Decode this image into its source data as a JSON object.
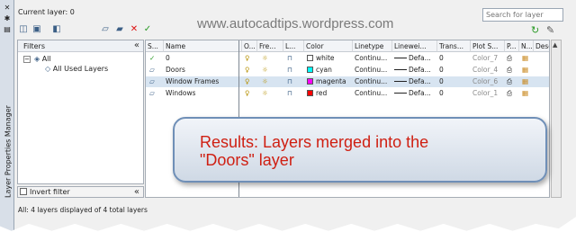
{
  "watermark": "www.autocadtips.wordpress.com",
  "header": {
    "current_layer": "Current layer: 0",
    "search_placeholder": "Search for layer"
  },
  "palette": {
    "title": "Layer Properties Manager",
    "icons": [
      "pin-icon",
      "close-icon",
      "properties-icon"
    ]
  },
  "toolbar": {
    "icons": [
      "new-property-filter-icon",
      "new-group-filter-icon",
      "layer-states-manager-icon",
      "new-layer-icon",
      "new-layer-vp-frozen-icon",
      "delete-layer-icon",
      "set-current-icon"
    ],
    "right_icons": [
      "refresh-icon",
      "settings-icon"
    ]
  },
  "filters": {
    "header": "Filters",
    "collapse": "«",
    "tree": [
      {
        "label": "All",
        "expander": "−"
      },
      {
        "label": "All Used Layers"
      }
    ],
    "invert_label": "Invert filter",
    "invert_checked": false
  },
  "layers": {
    "columns": [
      "S...",
      "Name",
      "O...",
      "Fre...",
      "L...",
      "Color",
      "Linetype",
      "Linewei...",
      "Trans...",
      "Plot S...",
      "P...",
      "N...",
      "Descri"
    ],
    "rows": [
      {
        "status": "✓",
        "name": "0",
        "color": "white",
        "color_hex": "#ffffff",
        "linetype": "Continu...",
        "lineweight": "Defa...",
        "transparency": "0",
        "plot_style": "Color_7",
        "selected": false
      },
      {
        "status": "",
        "name": "Doors",
        "color": "cyan",
        "color_hex": "#00ffff",
        "linetype": "Continu...",
        "lineweight": "Defa...",
        "transparency": "0",
        "plot_style": "Color_4",
        "selected": false
      },
      {
        "status": "",
        "name": "Window Frames",
        "color": "magenta",
        "color_hex": "#ff00ff",
        "linetype": "Continu...",
        "lineweight": "Defa...",
        "transparency": "0",
        "plot_style": "Color_6",
        "selected": true
      },
      {
        "status": "",
        "name": "Windows",
        "color": "red",
        "color_hex": "#ff0000",
        "linetype": "Continu...",
        "lineweight": "Defa...",
        "transparency": "0",
        "plot_style": "Color_1",
        "selected": false
      }
    ]
  },
  "status_bar": {
    "text": "All: 4 layers displayed of 4 total layers"
  },
  "callout": {
    "line1": "Results: Layers merged into the",
    "line2": "\"Doors\" layer"
  }
}
